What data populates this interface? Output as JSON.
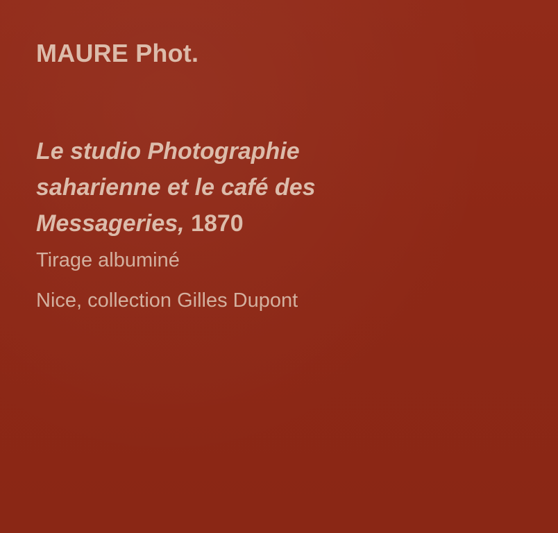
{
  "panel": {
    "background_color": "#8f2a18",
    "text_color": "#dcbcab"
  },
  "label": {
    "artist": "MAURE Phot.",
    "title_lines": [
      "Le studio Photographie",
      "saharienne et le café des",
      "Messageries,"
    ],
    "date": "1870",
    "technique": "Tirage albuminé",
    "collection": "Nice, collection Gilles Dupont"
  }
}
